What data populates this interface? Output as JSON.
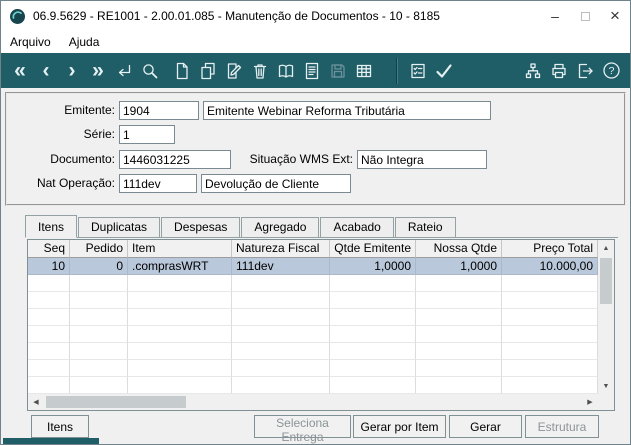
{
  "window": {
    "title": "06.9.5629 - RE1001 - 2.00.01.085 - Manutenção de Documentos - 10 - 8185",
    "controls": {
      "minimize": "–",
      "close": "×"
    }
  },
  "menu": {
    "items": [
      {
        "label": "Arquivo"
      },
      {
        "label": "Ajuda"
      }
    ]
  },
  "toolbar": {
    "glyphs": {
      "first": "«",
      "previous": "‹",
      "next": "›",
      "last": "»",
      "help": "?"
    },
    "icons": [
      "first",
      "previous",
      "next",
      "last",
      "go-to",
      "search",
      "new-document",
      "copy",
      "edit-document",
      "delete",
      "browse",
      "report",
      "save",
      "table",
      "checklist",
      "confirm",
      "structure",
      "print",
      "exit",
      "help"
    ],
    "disabled_icons": [
      "save"
    ]
  },
  "form": {
    "emitente": {
      "label": "Emitente:",
      "code": "1904",
      "name": "Emitente Webinar Reforma Tributária"
    },
    "serie": {
      "label": "Série:",
      "value": "1"
    },
    "documento": {
      "label": "Documento:",
      "value": "1446031225"
    },
    "situacao_wms": {
      "label": "Situação WMS Ext:",
      "value": "Não Integra"
    },
    "nat_operacao": {
      "label": "Nat Operação:",
      "code": "111dev",
      "desc": "Devolução de Cliente"
    }
  },
  "tabs": [
    {
      "label": "Itens",
      "active": true
    },
    {
      "label": "Duplicatas",
      "active": false
    },
    {
      "label": "Despesas",
      "active": false
    },
    {
      "label": "Agregado",
      "active": false
    },
    {
      "label": "Acabado",
      "active": false
    },
    {
      "label": "Rateio",
      "active": false
    }
  ],
  "table": {
    "columns": [
      {
        "label": "Seq",
        "align": "right"
      },
      {
        "label": "Pedido",
        "align": "right"
      },
      {
        "label": "Item",
        "align": "left"
      },
      {
        "label": "Natureza Fiscal",
        "align": "left"
      },
      {
        "label": "Qtde Emitente",
        "align": "right"
      },
      {
        "label": "Nossa Qtde",
        "align": "right"
      },
      {
        "label": "Preço Total",
        "align": "right"
      }
    ],
    "rows": [
      {
        "seq": "10",
        "pedido": "0",
        "item": ".comprasWRT",
        "natureza_fiscal": "111dev",
        "qtde_emitente": "1,0000",
        "nossa_qtde": "1,0000",
        "preco_total": "10.000,00",
        "selected": true
      }
    ]
  },
  "actions": {
    "itens": {
      "label": "Itens",
      "enabled": true
    },
    "seleciona_entrega": {
      "label": "Seleciona Entrega",
      "enabled": false
    },
    "gerar_por_item": {
      "label": "Gerar por Item",
      "enabled": true
    },
    "gerar": {
      "label": "Gerar",
      "enabled": true
    },
    "estrutura": {
      "label": "Estrutura",
      "enabled": false
    }
  },
  "colors": {
    "toolbar": "#1f5d67",
    "selected_row": "#b9c8da",
    "titlebar": "#ffffff"
  }
}
